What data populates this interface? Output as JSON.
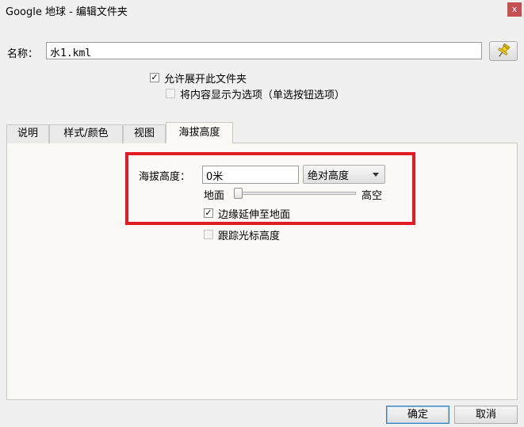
{
  "window": {
    "title": "Google 地球 -  编辑文件夹",
    "close_label": "x"
  },
  "form": {
    "name_label": "名称：",
    "name_value": "水1.kml",
    "allow_expand": {
      "label": "允许展开此文件夹",
      "checked": true
    },
    "show_as_options": {
      "label": "将内容显示为选项（单选按钮选项）",
      "checked": false
    }
  },
  "tabs": [
    {
      "label": "说明",
      "active": false
    },
    {
      "label": "样式/颜色",
      "active": false
    },
    {
      "label": "视图",
      "active": false
    },
    {
      "label": "海拔高度",
      "active": true
    }
  ],
  "altitude": {
    "label": "海拔高度：",
    "value": "0米",
    "mode": "绝对高度",
    "slider_min_label": "地面",
    "slider_max_label": "高空",
    "slider_level": 0,
    "extend_to_ground": {
      "label": "边缘延伸至地面",
      "checked": true
    },
    "track_cursor": {
      "label": "跟踪光标高度",
      "checked": false
    }
  },
  "colors": {
    "highlight": "#e21b24",
    "pin": "#f5d418"
  },
  "icons": {
    "pin_button": "pushpin-icon",
    "dropdown": "chevron-down-icon"
  },
  "buttons": {
    "ok": "确定",
    "cancel": "取消"
  }
}
